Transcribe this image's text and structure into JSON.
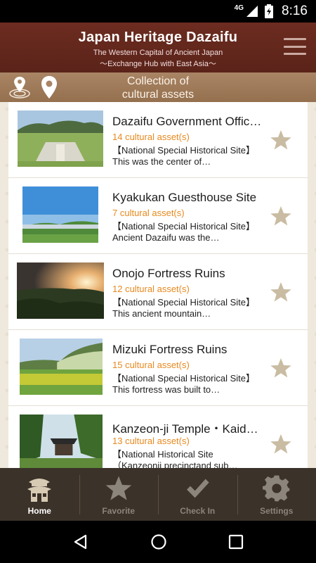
{
  "status_bar": {
    "network": "4G",
    "time": "8:16"
  },
  "header": {
    "title": "Japan Heritage Dazaifu",
    "subtitle1": "The Western Capital of Ancient Japan",
    "subtitle2": "～Exchange Hub with East Asia～"
  },
  "subbar": {
    "title_line1": "Collection of",
    "title_line2": "cultural assets"
  },
  "items": [
    {
      "title": "Dazaifu Government Offic…",
      "count": "14 cultural asset(s)",
      "desc": "【National Special Historical Site】This was the center of…"
    },
    {
      "title": "Kyakukan Guesthouse Site",
      "count": "7 cultural asset(s)",
      "desc": "【National Special Historical Site】Ancient Dazaifu was the…"
    },
    {
      "title": "Onojo Fortress Ruins",
      "count": "12 cultural asset(s)",
      "desc": "【National Special Historical Site】This ancient mountain…"
    },
    {
      "title": "Mizuki Fortress Ruins",
      "count": "15 cultural asset(s)",
      "desc": "【National Special Historical Site】This fortress was built to…"
    },
    {
      "title": "Kanzeon-ji Temple・Kaid…",
      "count": "13 cultural asset(s)",
      "desc": "【National Historical Site（Kanzeonji precinctand sub…"
    }
  ],
  "nav": {
    "home": "Home",
    "favorite": "Favorite",
    "checkin": "Check In",
    "settings": "Settings"
  },
  "colors": {
    "header": "#6d2c20",
    "subbar": "#a98565",
    "accent_count": "#e8891e",
    "star": "#c9bca2",
    "nav_bg": "#3b3229"
  }
}
